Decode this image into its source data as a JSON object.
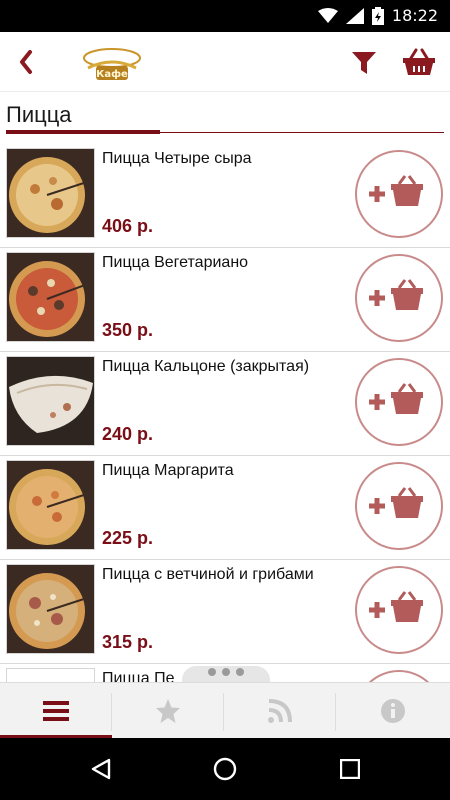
{
  "status_bar": {
    "time": "18:22",
    "icons": [
      "wifi-icon",
      "signal-icon",
      "battery-icon"
    ]
  },
  "app_bar": {
    "back_icon": "chevron-left-icon",
    "logo_text": "Кафе",
    "filter_icon": "funnel-icon",
    "basket_icon": "basket-icon"
  },
  "section": {
    "title": "Пицца"
  },
  "items": [
    {
      "name": "Пицца Четыре сыра",
      "price": "406 р."
    },
    {
      "name": "Пицца Вегетариано",
      "price": "350 р."
    },
    {
      "name": "Пицца Кальцоне (закрытая)",
      "price": "240 р."
    },
    {
      "name": "Пицца Маргарита",
      "price": "225 р."
    },
    {
      "name": "Пицца с ветчиной и грибами",
      "price": "315 р."
    },
    {
      "name": "Пицца Пе",
      "price": ""
    }
  ],
  "bottom_nav": {
    "tabs": [
      "menu-icon",
      "star-icon",
      "rss-icon",
      "info-icon"
    ],
    "active": 0
  },
  "colors": {
    "accent": "#7a0e16",
    "add_button_border": "#c98a8a",
    "add_button_icon": "#b35a5a"
  }
}
